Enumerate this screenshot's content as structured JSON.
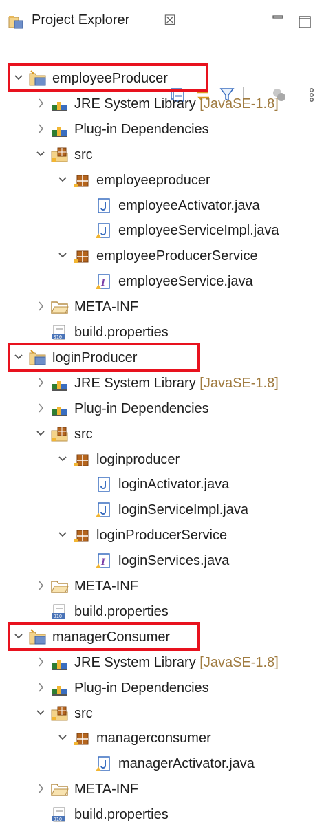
{
  "view": {
    "title": "Project Explorer",
    "close_glyph": "☒",
    "icon": "project-explorer-icon"
  },
  "toolbar": {
    "buttons": [
      {
        "name": "collapse-all-icon"
      },
      {
        "name": "link-with-editor-icon"
      },
      {
        "name": "filter-icon"
      },
      {
        "name": "working-sets-icon"
      },
      {
        "name": "view-menu-icon"
      }
    ]
  },
  "colors": {
    "highlight_border": "#e8121e",
    "decoration_text": "#a07b40",
    "selection": "#ffffff"
  },
  "tree": {
    "projects": [
      {
        "label": "employeeProducer",
        "expanded": true,
        "children": [
          {
            "label": "JRE System Library",
            "decoration": "[JavaSE-1.8]",
            "icon": "library-icon"
          },
          {
            "label": "Plug-in Dependencies",
            "icon": "library-icon"
          },
          {
            "label": "src",
            "icon": "source-folder-icon",
            "expanded": true,
            "children": [
              {
                "label": "employeeproducer",
                "icon": "package-icon",
                "expanded": true,
                "children": [
                  {
                    "label": "employeeActivator.java",
                    "icon": "java-file-icon"
                  },
                  {
                    "label": "employeeServiceImpl.java",
                    "icon": "java-file-warning-icon"
                  }
                ]
              },
              {
                "label": "employeeProducerService",
                "icon": "package-icon",
                "expanded": true,
                "children": [
                  {
                    "label": "employeeService.java",
                    "icon": "java-interface-icon"
                  }
                ]
              }
            ]
          },
          {
            "label": "META-INF",
            "icon": "folder-icon"
          },
          {
            "label": "build.properties",
            "icon": "properties-file-icon"
          }
        ]
      },
      {
        "label": "loginProducer",
        "expanded": true,
        "children": [
          {
            "label": "JRE System Library",
            "decoration": "[JavaSE-1.8]",
            "icon": "library-icon"
          },
          {
            "label": "Plug-in Dependencies",
            "icon": "library-icon"
          },
          {
            "label": "src",
            "icon": "source-folder-icon",
            "expanded": true,
            "children": [
              {
                "label": "loginproducer",
                "icon": "package-icon",
                "expanded": true,
                "children": [
                  {
                    "label": "loginActivator.java",
                    "icon": "java-file-icon"
                  },
                  {
                    "label": "loginServiceImpl.java",
                    "icon": "java-file-warning-icon"
                  }
                ]
              },
              {
                "label": "loginProducerService",
                "icon": "package-icon",
                "expanded": true,
                "children": [
                  {
                    "label": "loginServices.java",
                    "icon": "java-interface-icon"
                  }
                ]
              }
            ]
          },
          {
            "label": "META-INF",
            "icon": "folder-icon"
          },
          {
            "label": "build.properties",
            "icon": "properties-file-icon"
          }
        ]
      },
      {
        "label": "managerConsumer",
        "expanded": true,
        "children": [
          {
            "label": "JRE System Library",
            "decoration": "[JavaSE-1.8]",
            "icon": "library-icon"
          },
          {
            "label": "Plug-in Dependencies",
            "icon": "library-icon"
          },
          {
            "label": "src",
            "icon": "source-folder-icon",
            "expanded": true,
            "children": [
              {
                "label": "managerconsumer",
                "icon": "package-icon",
                "expanded": true,
                "children": [
                  {
                    "label": "managerActivator.java",
                    "icon": "java-file-warning-icon"
                  }
                ]
              }
            ]
          },
          {
            "label": "META-INF",
            "icon": "folder-icon"
          },
          {
            "label": "build.properties",
            "icon": "properties-file-icon"
          }
        ]
      }
    ]
  }
}
